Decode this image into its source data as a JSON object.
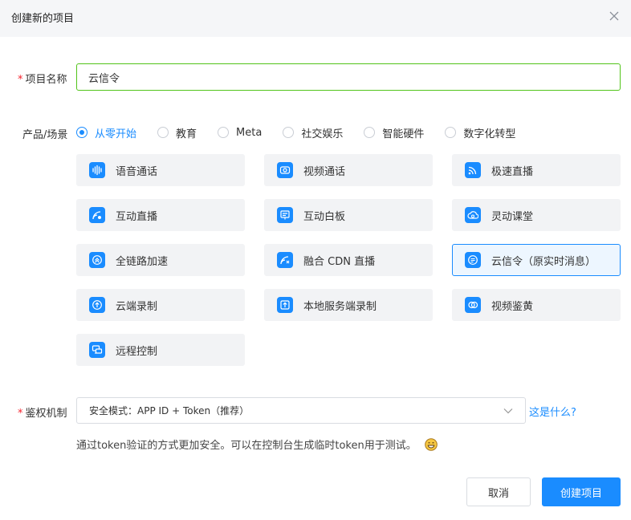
{
  "dialog": {
    "title": "创建新的项目"
  },
  "form": {
    "name_label": "项目名称",
    "name_required_mark": "*",
    "name_value": "云信令",
    "scene_label": "产品/场景",
    "scenes": [
      {
        "label": "从零开始",
        "selected": true
      },
      {
        "label": "教育",
        "selected": false
      },
      {
        "label": "Meta",
        "selected": false
      },
      {
        "label": "社交娱乐",
        "selected": false
      },
      {
        "label": "智能硬件",
        "selected": false
      },
      {
        "label": "数字化转型",
        "selected": false
      }
    ],
    "products": [
      {
        "label": "语音通话",
        "icon": "voice-wave-icon",
        "selected": false
      },
      {
        "label": "视频通话",
        "icon": "camera-icon",
        "selected": false
      },
      {
        "label": "极速直播",
        "icon": "broadcast-icon",
        "selected": false
      },
      {
        "label": "互动直播",
        "icon": "live-icon",
        "selected": false
      },
      {
        "label": "互动白板",
        "icon": "whiteboard-icon",
        "selected": false
      },
      {
        "label": "灵动课堂",
        "icon": "cloud-classroom-icon",
        "selected": false
      },
      {
        "label": "全链路加速",
        "icon": "accelerate-icon",
        "selected": false
      },
      {
        "label": "融合 CDN 直播",
        "icon": "cdn-icon",
        "selected": false
      },
      {
        "label": "云信令（原实时消息）",
        "icon": "message-icon",
        "selected": true
      },
      {
        "label": "云端录制",
        "icon": "cloud-upload-icon",
        "selected": false
      },
      {
        "label": "本地服务端录制",
        "icon": "server-upload-icon",
        "selected": false
      },
      {
        "label": "视频鉴黄",
        "icon": "video-review-icon",
        "selected": false
      },
      {
        "label": "远程控制",
        "icon": "remote-control-icon",
        "selected": false
      }
    ],
    "auth_label": "鉴权机制",
    "auth_required_mark": "*",
    "auth_value": "安全模式：APP ID + Token（推荐）",
    "auth_help_link": "这是什么?",
    "auth_hint": "通过token验证的方式更加安全。可以在控制台生成临时token用于测试。"
  },
  "footer": {
    "cancel_label": "取消",
    "create_label": "创建项目"
  },
  "colors": {
    "accent": "#1a8cff",
    "input_border_valid": "#52c41a",
    "required": "#f5222d",
    "card_bg": "#f2f3f5"
  }
}
